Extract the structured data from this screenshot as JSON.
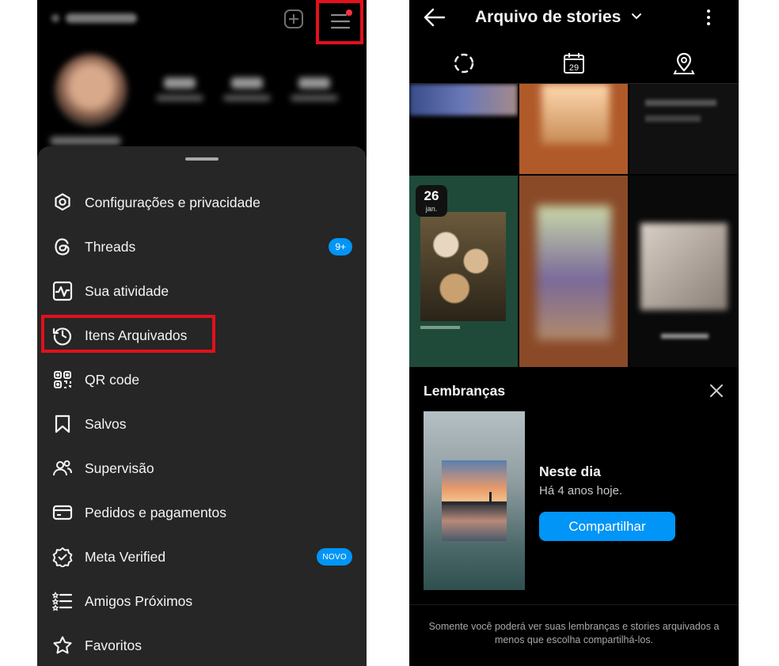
{
  "left": {
    "menu_items": [
      {
        "label": "Configurações e privacidade",
        "icon": "settings-icon"
      },
      {
        "label": "Threads",
        "icon": "threads-icon",
        "badge": "9+"
      },
      {
        "label": "Sua atividade",
        "icon": "activity-icon"
      },
      {
        "label": "Itens Arquivados",
        "icon": "archive-icon"
      },
      {
        "label": "QR code",
        "icon": "qr-code-icon"
      },
      {
        "label": "Salvos",
        "icon": "bookmark-icon"
      },
      {
        "label": "Supervisão",
        "icon": "supervision-icon"
      },
      {
        "label": "Pedidos e pagamentos",
        "icon": "card-icon"
      },
      {
        "label": "Meta Verified",
        "icon": "verified-icon",
        "badge": "NOVO"
      },
      {
        "label": "Amigos Próximos",
        "icon": "close-friends-icon"
      },
      {
        "label": "Favoritos",
        "icon": "star-icon"
      }
    ],
    "highlight_color": "#e3101d"
  },
  "right": {
    "title": "Arquivo de stories",
    "date_chip": {
      "day": "26",
      "month": "jan."
    },
    "memories": {
      "title": "Lembranças",
      "heading": "Neste dia",
      "subtitle": "Há 4 anos hoje.",
      "share_label": "Compartilhar",
      "footer": "Somente você poderá ver suas lembranças e stories arquivados a menos que escolha compartilhá-los."
    },
    "calendar_icon_number": "29"
  },
  "colors": {
    "accent": "#0095f6",
    "sheet": "#262626",
    "background": "#000000"
  }
}
